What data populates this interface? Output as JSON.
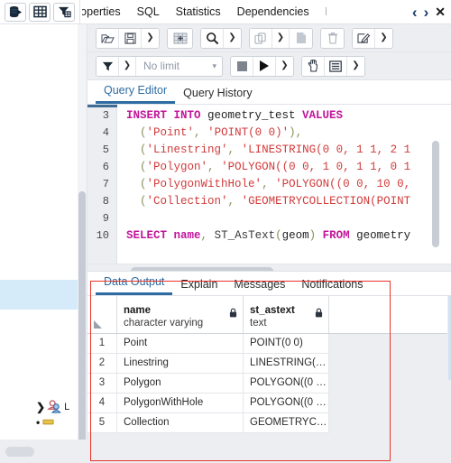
{
  "app": {
    "name": "pgAdmin Query Tool",
    "accent_color": "#2d6ca2",
    "annotation_color": "#e8342a"
  },
  "top_bar": {
    "left_buttons": [
      {
        "name": "browser-object-icon",
        "label": "Object Browser"
      },
      {
        "name": "grid-table-icon",
        "label": "Properties Grid"
      },
      {
        "name": "filter-table-icon",
        "label": "Filtered Rows"
      }
    ],
    "object_tabs": [
      {
        "label": "roperties",
        "clipped": true,
        "active": false
      },
      {
        "label": "SQL",
        "clipped": false,
        "active": false
      },
      {
        "label": "Statistics",
        "clipped": false,
        "active": false
      },
      {
        "label": "Dependencies",
        "clipped": false,
        "active": false
      },
      {
        "label": "D",
        "clipped": true,
        "active": false
      }
    ],
    "nav": {
      "prev_label": "‹",
      "next_label": "›",
      "close_label": "✕"
    }
  },
  "sidebar": {
    "tree_items": [
      {
        "label": "L",
        "icon": "login-roles-icon",
        "expanded": false
      }
    ]
  },
  "toolbar_row1": [
    {
      "name": "open-file-button",
      "icon": "open-folder-icon",
      "label": "Open File"
    },
    {
      "name": "save-button",
      "icon": "save-disk-icon",
      "label": "Save"
    },
    {
      "name": "save-options-button",
      "icon": "chevron-down-icon",
      "label": "Save options"
    },
    {
      "name": "paste-grid-button",
      "icon": "grid-insert-icon",
      "label": "Paste rows"
    },
    {
      "name": "find-button",
      "icon": "search-icon",
      "label": "Find"
    },
    {
      "name": "find-options-button",
      "icon": "chevron-down-icon",
      "label": "Find options"
    },
    {
      "name": "copy-button",
      "icon": "copy-icon",
      "label": "Copy"
    },
    {
      "name": "copy-options-button",
      "icon": "chevron-down-icon",
      "label": "Copy options"
    },
    {
      "name": "paste-button",
      "icon": "paste-icon",
      "label": "Paste"
    },
    {
      "name": "delete-button",
      "icon": "trash-icon",
      "label": "Delete"
    },
    {
      "name": "edit-button",
      "icon": "edit-pencil-icon",
      "label": "Edit"
    },
    {
      "name": "edit-options-button",
      "icon": "chevron-down-icon",
      "label": "Edit options"
    }
  ],
  "toolbar_row2": {
    "filter_button": {
      "name": "filter-button",
      "icon": "funnel-icon",
      "label": "Filter"
    },
    "filter_options_button": {
      "name": "filter-options-button",
      "icon": "chevron-down-icon",
      "label": "Filter options"
    },
    "row_limit": {
      "name": "row-limit-select",
      "value": "No limit",
      "caret": "▾"
    },
    "stop_button": {
      "name": "stop-query-button",
      "icon": "stop-square-icon",
      "label": "Stop"
    },
    "execute_button": {
      "name": "execute-query-button",
      "icon": "play-triangle-icon",
      "label": "Execute"
    },
    "execute_options_button": {
      "name": "execute-options-button",
      "icon": "chevron-down-icon",
      "label": "Execute options"
    },
    "macro_button": {
      "name": "manual-commit-button",
      "icon": "hand-icon",
      "label": "Commit mode"
    },
    "explain_button": {
      "name": "explain-panel-button",
      "icon": "panel-list-icon",
      "label": "Explain options"
    },
    "explain_options_button": {
      "name": "explain-options-button",
      "icon": "chevron-down-icon",
      "label": "More options"
    }
  },
  "editor_tabs": [
    {
      "label": "Query Editor",
      "active": true
    },
    {
      "label": "Query History",
      "active": false
    }
  ],
  "editor": {
    "first_line_number": 3,
    "line_numbers": [
      3,
      4,
      5,
      6,
      7,
      8,
      9,
      10
    ],
    "lines": [
      {
        "n": 3,
        "text": "INSERT INTO geometry_test VALUES"
      },
      {
        "n": 4,
        "text": "  ('Point', 'POINT(0 0)'),"
      },
      {
        "n": 5,
        "text": "  ('Linestring', 'LINESTRING(0 0, 1 1, 2 1"
      },
      {
        "n": 6,
        "text": "  ('Polygon', 'POLYGON((0 0, 1 0, 1 1, 0 1"
      },
      {
        "n": 7,
        "text": "  ('PolygonWithHole', 'POLYGON((0 0, 10 0,"
      },
      {
        "n": 8,
        "text": "  ('Collection', 'GEOMETRYCOLLECTION(POINT"
      },
      {
        "n": 9,
        "text": ""
      },
      {
        "n": 10,
        "text": "SELECT name, ST_AsText(geom) FROM geometry"
      }
    ]
  },
  "output_tabs": [
    {
      "label": "Data Output",
      "active": true
    },
    {
      "label": "Explain",
      "active": false
    },
    {
      "label": "Messages",
      "active": false
    },
    {
      "label": "Notifications",
      "active": false
    }
  ],
  "results": {
    "columns": [
      {
        "name": "name",
        "type": "character varying",
        "locked": true
      },
      {
        "name": "st_astext",
        "type": "text",
        "locked": true
      }
    ],
    "rows": [
      {
        "n": "1",
        "name": "Point",
        "st_astext": "POINT(0 0)"
      },
      {
        "n": "2",
        "name": "Linestring",
        "st_astext": "LINESTRING(…"
      },
      {
        "n": "3",
        "name": "Polygon",
        "st_astext": "POLYGON((0 …"
      },
      {
        "n": "4",
        "name": "PolygonWithHole",
        "st_astext": "POLYGON((0 …"
      },
      {
        "n": "5",
        "name": "Collection",
        "st_astext": "GEOMETRYC…"
      }
    ]
  }
}
